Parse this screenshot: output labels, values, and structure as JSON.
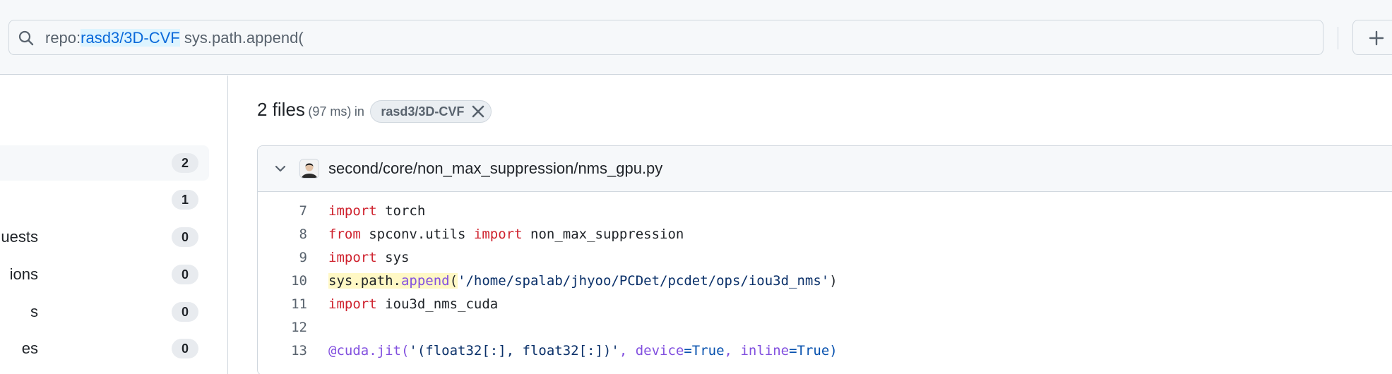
{
  "search": {
    "qualifier_key": "repo:",
    "qualifier_value": "rasd3/3D-CVF",
    "query": " sys.path.append("
  },
  "sidebar": {
    "items": [
      {
        "label": "",
        "count": "2",
        "active": true
      },
      {
        "label": "",
        "count": "1",
        "active": false
      },
      {
        "label": "uests",
        "count": "0",
        "active": false
      },
      {
        "label": "ions",
        "count": "0",
        "active": false
      },
      {
        "label": "s",
        "count": "0",
        "active": false
      },
      {
        "label": "es",
        "count": "0",
        "active": false
      }
    ]
  },
  "results": {
    "count_label": "2 files",
    "time_label": "(97 ms)",
    "in_label": "in",
    "repo_chip": "rasd3/3D-CVF"
  },
  "file": {
    "path": "second/core/non_max_suppression/nms_gpu.py",
    "lines": [
      {
        "num": "7",
        "parts": [
          {
            "t": "import",
            "c": "kw"
          },
          {
            "t": " torch",
            "c": ""
          }
        ]
      },
      {
        "num": "8",
        "parts": [
          {
            "t": "from",
            "c": "kw"
          },
          {
            "t": " spconv.utils ",
            "c": ""
          },
          {
            "t": "import",
            "c": "kw"
          },
          {
            "t": " non_max_suppression",
            "c": ""
          }
        ]
      },
      {
        "num": "9",
        "parts": [
          {
            "t": "import",
            "c": "kw"
          },
          {
            "t": " sys",
            "c": ""
          }
        ]
      },
      {
        "num": "10",
        "parts": [
          {
            "t": "sys.path.",
            "c": "hl"
          },
          {
            "t": "append",
            "c": "fn hl"
          },
          {
            "t": "(",
            "c": "hl"
          },
          {
            "t": "'/home/spalab/jhyoo/PCDet/pcdet/ops/iou3d_nms'",
            "c": "str"
          },
          {
            "t": ")",
            "c": ""
          }
        ]
      },
      {
        "num": "11",
        "parts": [
          {
            "t": "import",
            "c": "kw"
          },
          {
            "t": " iou3d_nms_cuda",
            "c": ""
          }
        ]
      },
      {
        "num": "12",
        "parts": []
      },
      {
        "num": "13",
        "parts": [
          {
            "t": "@cuda.jit(",
            "c": "fn"
          },
          {
            "t": "'(float32[:], float32[:])'",
            "c": "str"
          },
          {
            "t": ", ",
            "c": "fn"
          },
          {
            "t": "device",
            "c": "fn"
          },
          {
            "t": "=True",
            "c": "prm"
          },
          {
            "t": ", ",
            "c": "fn"
          },
          {
            "t": "inline",
            "c": "fn"
          },
          {
            "t": "=True)",
            "c": "prm"
          }
        ]
      }
    ]
  },
  "icons": {
    "search": "search-icon",
    "plus": "plus-icon",
    "chip_close": "close-icon",
    "chevron": "chevron-down-icon",
    "avatar": "avatar"
  },
  "colors": {
    "accent": "#0969da",
    "keyword": "#cf222e",
    "string": "#0a3069",
    "function": "#8250df",
    "highlight": "#fff8c5"
  }
}
